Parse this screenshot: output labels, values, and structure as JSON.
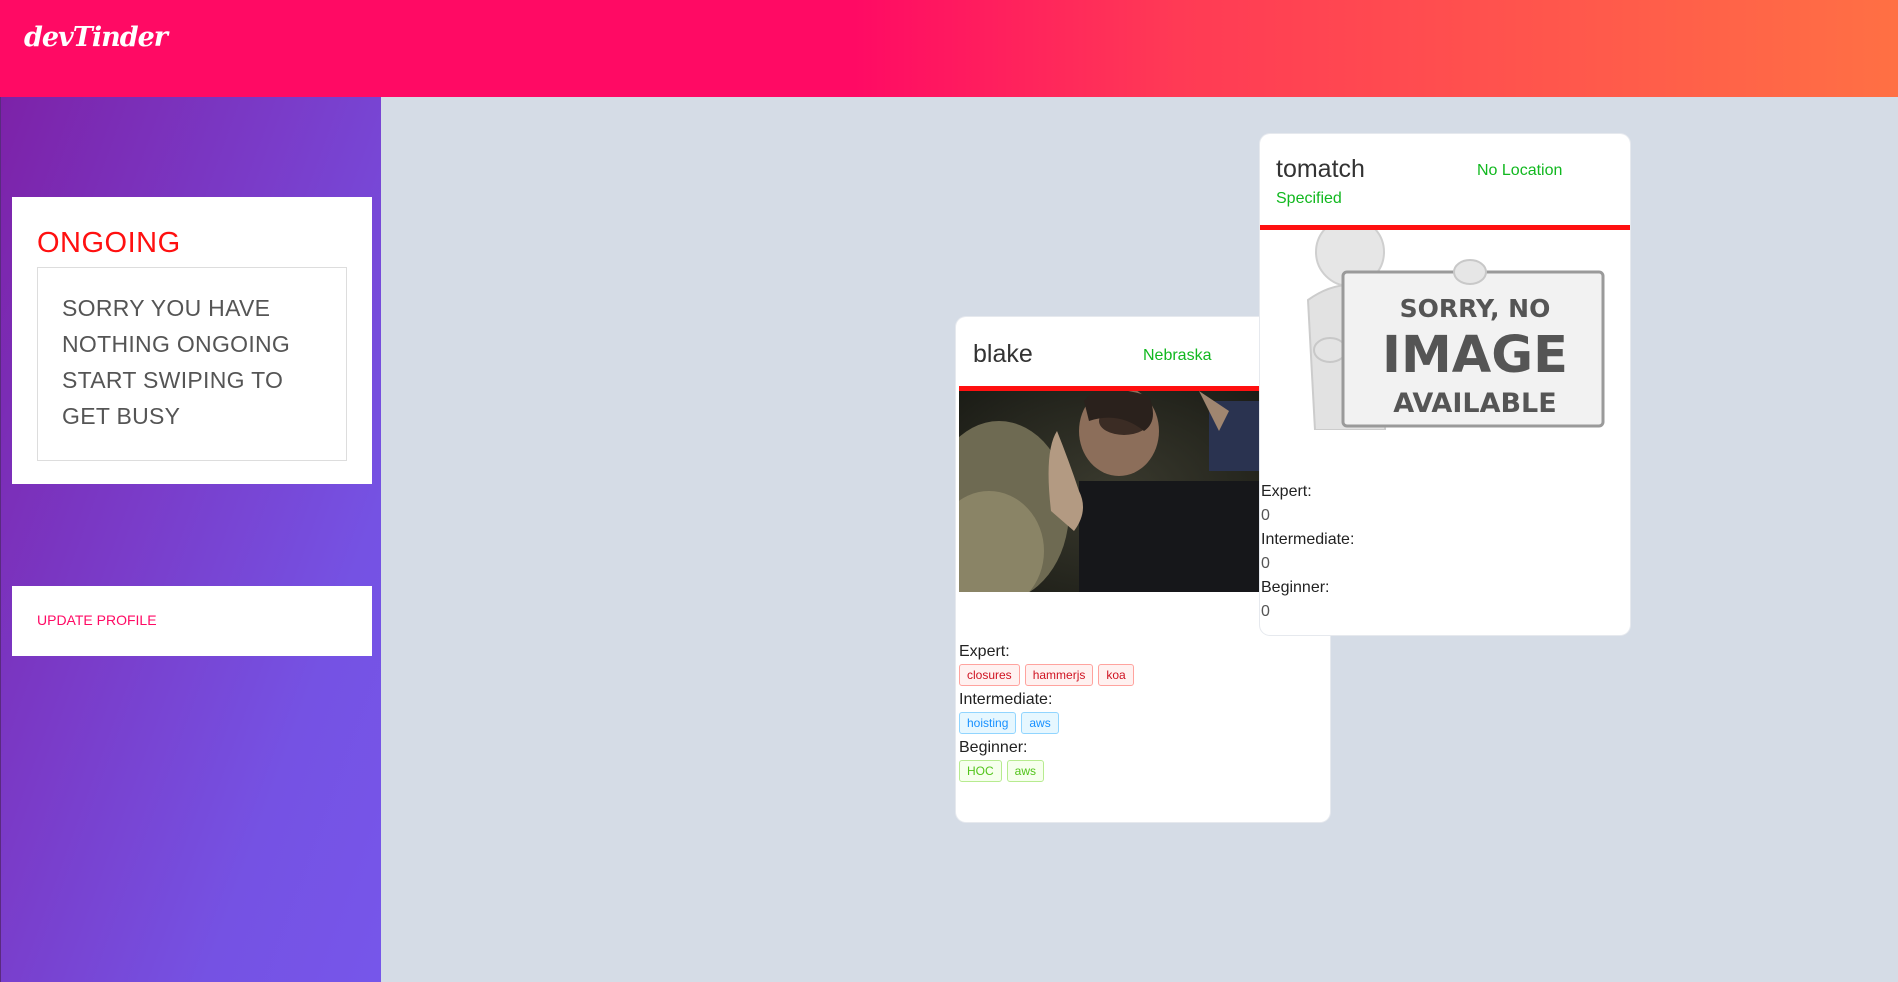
{
  "header": {
    "logo_text": "devTinder"
  },
  "sidebar": {
    "ongoing_title": "ONGOING",
    "empty_message_lines": [
      "SORRY YOU HAVE",
      "NOTHING ONGOING",
      "START SWIPING TO",
      "GET BUSY"
    ],
    "update_profile_label": "UPDATE PROFILE"
  },
  "cards": [
    {
      "name": "blake",
      "location": "Nebraska",
      "skills": {
        "expert_label": "Expert:",
        "expert": [
          "closures",
          "hammerjs",
          "koa"
        ],
        "intermediate_label": "Intermediate:",
        "intermediate": [
          "hoisting",
          "aws"
        ],
        "beginner_label": "Beginner:",
        "beginner": [
          "HOC",
          "aws"
        ]
      }
    },
    {
      "name": "tomatch",
      "location_line1": "No Location",
      "location_line2": "Specified",
      "image_placeholder": [
        "SORRY, NO",
        "IMAGE",
        "AVAILABLE"
      ],
      "skills": {
        "expert_label": "Expert:",
        "expert_value": "0",
        "intermediate_label": "Intermediate:",
        "intermediate_value": "0",
        "beginner_label": "Beginner:",
        "beginner_value": "0"
      }
    }
  ],
  "colors": {
    "brand_pink": "#ff0a64",
    "sidebar_purple": "#7a3bc8",
    "alert_red": "#ff1010",
    "location_green": "#11b81f",
    "canvas_bg": "#d5dce6"
  }
}
